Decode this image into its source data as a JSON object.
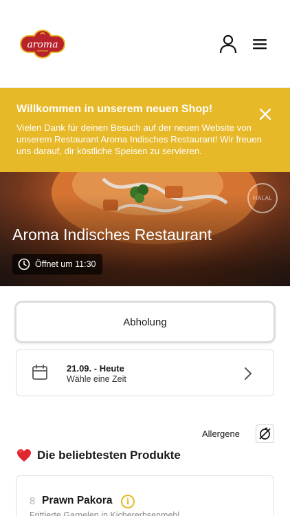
{
  "header": {
    "logo_text": "aroma",
    "logo_icon": "aroma-logo",
    "user_icon": "user-icon",
    "menu_icon": "hamburger-menu-icon"
  },
  "banner": {
    "title": "Willkommen in unserem neuen Shop!",
    "text": "Vielen Dank für deinen Besuch auf der neuen Website von unserem Restaurant Aroma Indisches Restaurant! Wir freuen uns darauf, dir köstliche Speisen zu servieren.",
    "close_icon": "close-icon",
    "color": "#e7b827"
  },
  "hero": {
    "title": "Aroma Indisches Restaurant",
    "hours": "Öffnet um 11:30",
    "halal_badge": "HALAL"
  },
  "order": {
    "pickup_label": "Abholung",
    "date_main": "21.09. - Heute",
    "date_sub": "Wähle eine Zeit"
  },
  "allergens": {
    "label": "Allergene"
  },
  "popular": {
    "title": "Die beliebtesten Produkte",
    "items": [
      {
        "number": "8",
        "name": "Prawn Pakora",
        "description": "Frittierte Garnelen in Kichererbsenmehl"
      }
    ]
  }
}
